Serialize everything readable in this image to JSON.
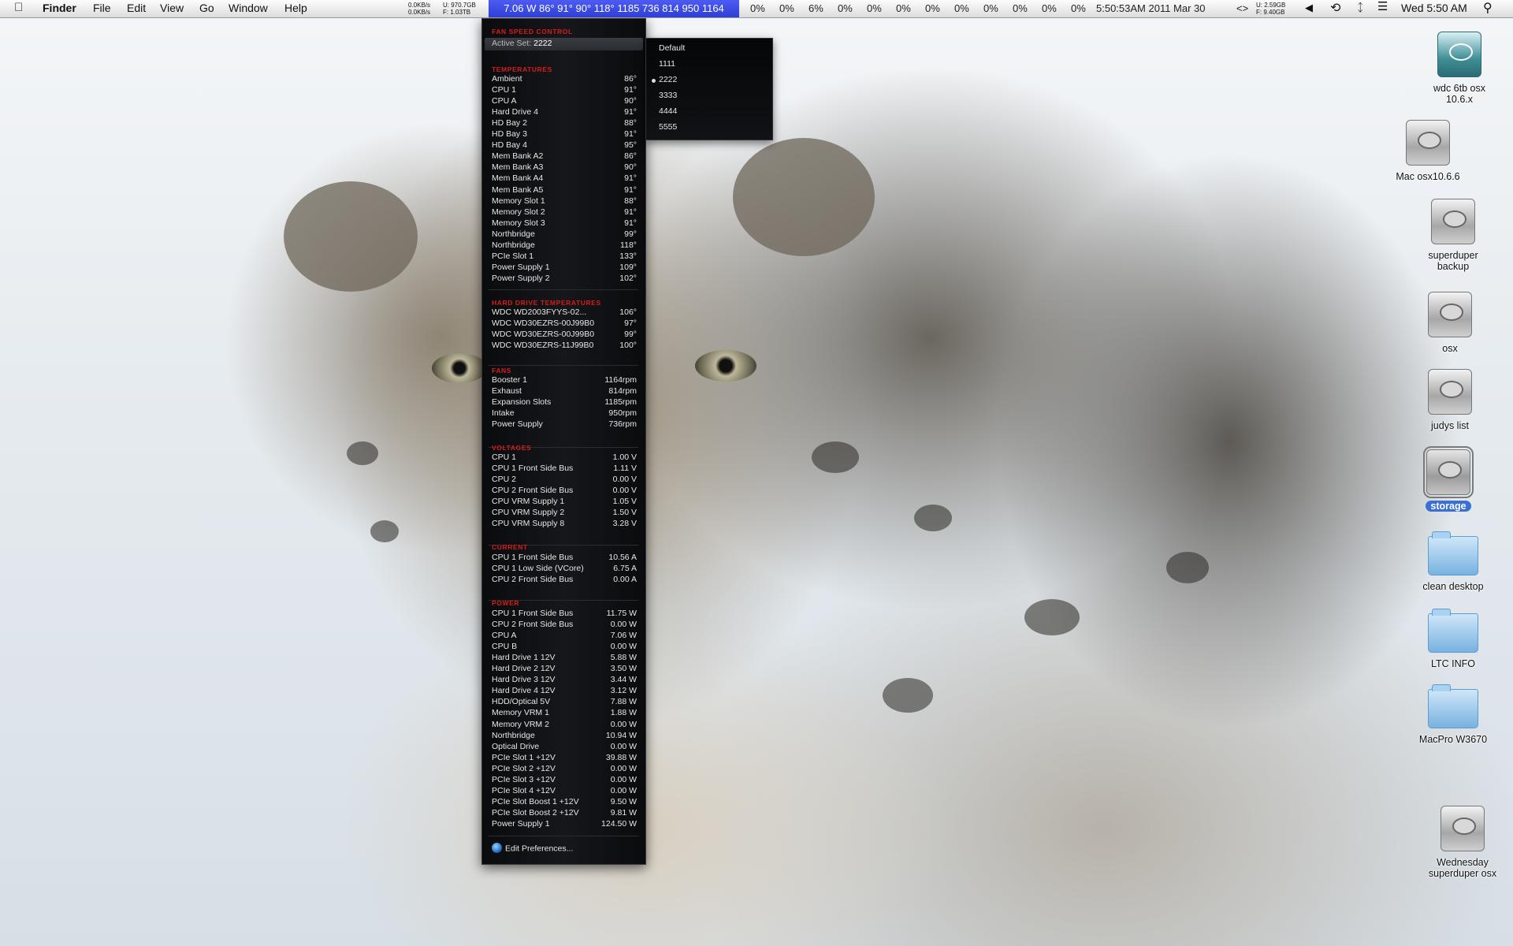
{
  "menubar": {
    "apple": "",
    "app": "Finder",
    "menus": [
      "File",
      "Edit",
      "View",
      "Go",
      "Window",
      "Help"
    ],
    "net_up": "0.0KB/s",
    "net_down": "0.0KB/s",
    "disk1_u": "U: 970.7GB",
    "disk1_f": "F: 1.03TB",
    "istat_strip": "7.06 W 86° 91° 90° 118° 1185 736 814 950 1164",
    "cpu_percents": [
      "0%",
      "0%",
      "6%",
      "0%",
      "0%",
      "0%",
      "0%",
      "0%",
      "0%",
      "0%",
      "0%",
      "0%"
    ],
    "datetime": "5:50:53AM 2011 Mar 30",
    "arrows": "<>",
    "mem_u": "U: 2.59GB",
    "mem_f": "F: 9.40GB",
    "clock": "Wed 5:50 AM"
  },
  "istat": {
    "fan_title": "FAN SPEED CONTROL",
    "active_set_label": "Active Set:",
    "active_set_value": "2222",
    "sections": {
      "temperatures": {
        "title": "TEMPERATURES",
        "rows": [
          [
            "Ambient",
            "86°"
          ],
          [
            "CPU 1",
            "91°"
          ],
          [
            "CPU A",
            "90°"
          ],
          [
            "Hard Drive 4",
            "91°"
          ],
          [
            "HD Bay 2",
            "88°"
          ],
          [
            "HD Bay 3",
            "91°"
          ],
          [
            "HD Bay 4",
            "95°"
          ],
          [
            "Mem Bank A2",
            "86°"
          ],
          [
            "Mem Bank A3",
            "90°"
          ],
          [
            "Mem Bank A4",
            "91°"
          ],
          [
            "Mem Bank A5",
            "91°"
          ],
          [
            "Memory Slot 1",
            "88°"
          ],
          [
            "Memory Slot 2",
            "91°"
          ],
          [
            "Memory Slot 3",
            "91°"
          ],
          [
            "Northbridge",
            "99°"
          ],
          [
            "Northbridge",
            "118°"
          ],
          [
            "PCIe Slot 1",
            "133°"
          ],
          [
            "Power Supply 1",
            "109°"
          ],
          [
            "Power Supply 2",
            "102°"
          ]
        ]
      },
      "hdd": {
        "title": "HARD DRIVE TEMPERATURES",
        "rows": [
          [
            "WDC WD2003FYYS-02...",
            "106°"
          ],
          [
            "WDC WD30EZRS-00J99B0",
            "97°"
          ],
          [
            "WDC WD30EZRS-00J99B0",
            "99°"
          ],
          [
            "WDC WD30EZRS-11J99B0",
            "100°"
          ]
        ]
      },
      "fans": {
        "title": "FANS",
        "rows": [
          [
            "Booster 1",
            "1164rpm"
          ],
          [
            "Exhaust",
            "814rpm"
          ],
          [
            "Expansion Slots",
            "1185rpm"
          ],
          [
            "Intake",
            "950rpm"
          ],
          [
            "Power Supply",
            "736rpm"
          ]
        ]
      },
      "voltages": {
        "title": "VOLTAGES",
        "rows": [
          [
            "CPU 1",
            "1.00 V"
          ],
          [
            "CPU 1 Front Side Bus",
            "1.11 V"
          ],
          [
            "CPU 2",
            "0.00 V"
          ],
          [
            "CPU 2 Front Side Bus",
            "0.00 V"
          ],
          [
            "CPU VRM Supply 1",
            "1.05 V"
          ],
          [
            "CPU VRM Supply 2",
            "1.50 V"
          ],
          [
            "CPU VRM Supply 8",
            "3.28 V"
          ]
        ]
      },
      "current": {
        "title": "CURRENT",
        "rows": [
          [
            "CPU 1 Front Side Bus",
            "10.56 A"
          ],
          [
            "CPU 1 Low Side (VCore)",
            "6.75 A"
          ],
          [
            "CPU 2 Front Side Bus",
            "0.00 A"
          ]
        ]
      },
      "power": {
        "title": "POWER",
        "rows": [
          [
            "CPU 1 Front Side Bus",
            "11.75 W"
          ],
          [
            "CPU 2 Front Side Bus",
            "0.00 W"
          ],
          [
            "CPU A",
            "7.06 W"
          ],
          [
            "CPU B",
            "0.00 W"
          ],
          [
            "Hard Drive 1 12V",
            "5.88 W"
          ],
          [
            "Hard Drive 2 12V",
            "3.50 W"
          ],
          [
            "Hard Drive 3 12V",
            "3.44 W"
          ],
          [
            "Hard Drive 4 12V",
            "3.12 W"
          ],
          [
            "HDD/Optical 5V",
            "7.88 W"
          ],
          [
            "Memory VRM 1",
            "1.88 W"
          ],
          [
            "Memory VRM 2",
            "0.00 W"
          ],
          [
            "Northbridge",
            "10.94 W"
          ],
          [
            "Optical Drive",
            "0.00 W"
          ],
          [
            "PCIe Slot 1 +12V",
            "39.88 W"
          ],
          [
            "PCIe Slot 2 +12V",
            "0.00 W"
          ],
          [
            "PCIe Slot 3 +12V",
            "0.00 W"
          ],
          [
            "PCIe Slot 4 +12V",
            "0.00 W"
          ],
          [
            "PCIe Slot Boost 1 +12V",
            "9.50 W"
          ],
          [
            "PCIe Slot Boost 2 +12V",
            "9.81 W"
          ],
          [
            "Power Supply 1",
            "124.50 W"
          ]
        ]
      }
    },
    "edit_prefs": "Edit Preferences..."
  },
  "submenu": {
    "options": [
      "Default",
      "1111",
      "2222",
      "3333",
      "4444",
      "5555"
    ],
    "selected": "2222"
  },
  "desktop_icons": [
    {
      "label1": "wdc 6tb osx",
      "label2": "10.6.x",
      "kind": "timemachine"
    },
    {
      "label1": "Mac  osx10.6.6",
      "label2": "",
      "kind": "drive"
    },
    {
      "label1": "superduper",
      "label2": "backup",
      "kind": "drive"
    },
    {
      "label1": "osx",
      "label2": "",
      "kind": "drive"
    },
    {
      "label1": "judys list",
      "label2": "",
      "kind": "drive"
    },
    {
      "label1": "storage",
      "label2": "",
      "kind": "drive-selected"
    },
    {
      "label1": "clean desktop",
      "label2": "",
      "kind": "folder"
    },
    {
      "label1": "LTC INFO",
      "label2": "",
      "kind": "folder"
    },
    {
      "label1": "MacPro W3670",
      "label2": "",
      "kind": "folder"
    },
    {
      "label1": "Wednesday",
      "label2": "superduper osx",
      "kind": "drive"
    }
  ]
}
